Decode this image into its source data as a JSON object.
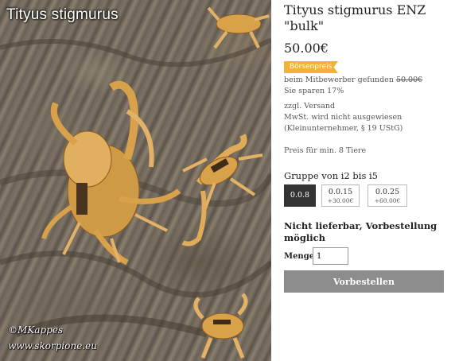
{
  "photo": {
    "title": "Tityus stigmurus",
    "watermark_line1": "©MKappes",
    "watermark_line2": "www.skorpione.eu"
  },
  "product": {
    "title": "Tityus stigmurus ENZ \"bulk\"",
    "price": "50.00€",
    "badge": "Börsenpreis",
    "competitor_text": "beim Mitbewerber gefunden",
    "competitor_price": "50.00€",
    "savings": "Sie sparen 17%",
    "shipping": "zzgl. Versand",
    "vat": "MwSt. wird nicht ausgewiesen",
    "vat_note": "(Kleinunternehmer, § 19 UStG)",
    "min_quantity": "Preis für min. 8 Tiere"
  },
  "variants": {
    "label": "Gruppe von i2 bis i5",
    "options": [
      {
        "label": "0.0.8",
        "extra": "",
        "selected": true
      },
      {
        "label": "0.0.15",
        "extra": "+30.00€",
        "selected": false
      },
      {
        "label": "0.0.25",
        "extra": "+60.00€",
        "selected": false
      }
    ]
  },
  "availability": "Nicht lieferbar, Vorbestellung möglich",
  "quantity": {
    "label": "Menge:",
    "value": "1"
  },
  "order_button": "Vorbestellen",
  "colors": {
    "badge": "#f2b23a",
    "button": "#8c8c8c",
    "selected_variant": "#333333"
  }
}
